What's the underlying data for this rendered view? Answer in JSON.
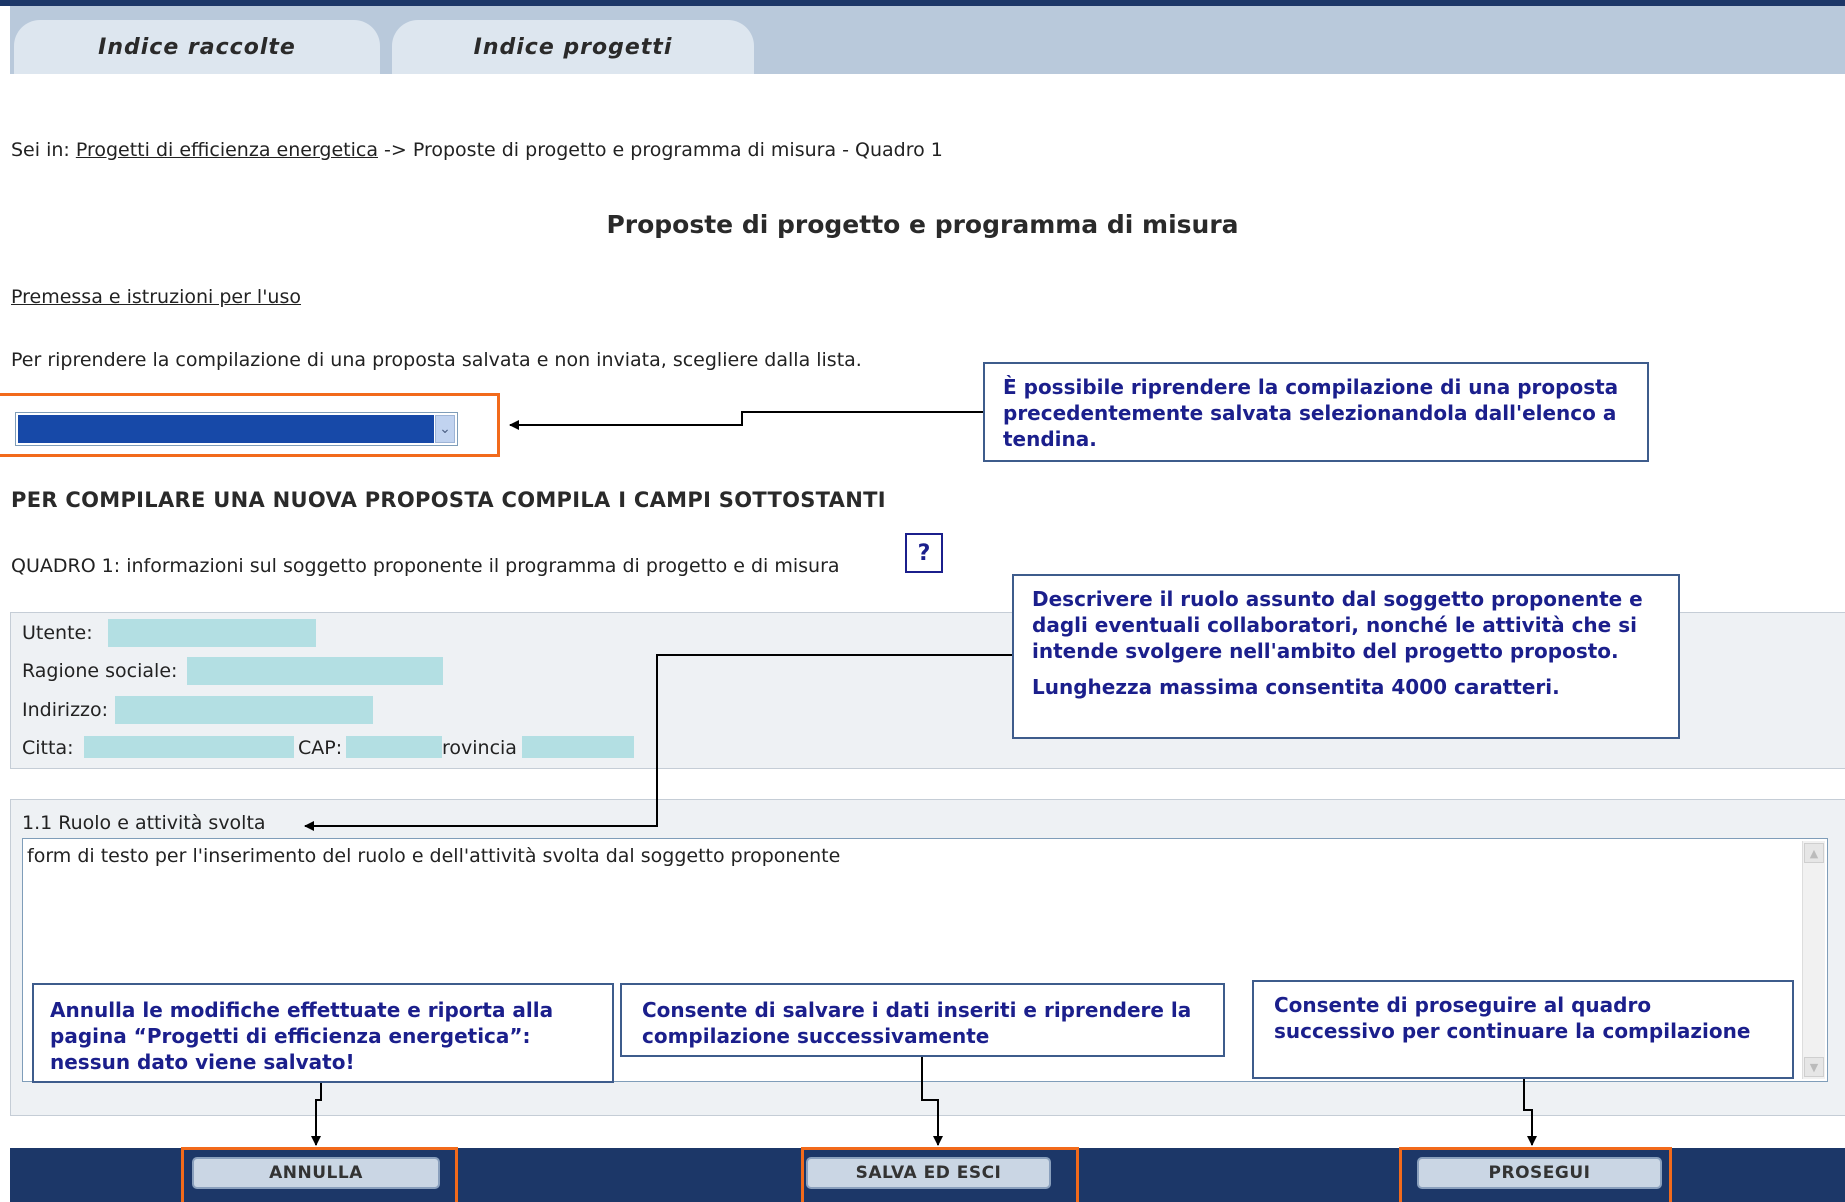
{
  "tabs": [
    {
      "label": "Indice raccolte"
    },
    {
      "label": "Indice progetti"
    }
  ],
  "breadcrumb": {
    "prefix": "Sei in:",
    "link": "Progetti di efficienza energetica",
    "current": "-> Proposte di progetto e programma di misura - Quadro 1"
  },
  "page_title": "Proposte di progetto e programma di misura",
  "instructions_link": "Premessa e istruzioni per l'uso",
  "resume_text": "Per riprendere la compilazione di una proposta salvata e non inviata, scegliere dalla lista.",
  "new_proposal_heading": "PER COMPILARE UNA NUOVA PROPOSTA COMPILA I CAMPI SOTTOSTANTI",
  "quadro_label": "QUADRO 1: informazioni sul soggetto proponente il programma di progetto e di misura",
  "help_icon": "help-cursor-icon",
  "fields": {
    "utente": "Utente:",
    "ragione_sociale": "Ragione sociale:",
    "indirizzo": "Indirizzo:",
    "citta": "Citta:",
    "cap": "CAP:",
    "provincia": "rovincia"
  },
  "section_1_1": {
    "label": "1.1 Ruolo e attività svolta",
    "textarea_value": "form di testo per l'inserimento del ruolo e dell'attività svolta dal soggetto proponente"
  },
  "callouts": {
    "dropdown": "È possibile riprendere la compilazione di una proposta precedentemente salvata selezionandola dall'elenco a tendina.",
    "role_line1": "Descrivere il ruolo assunto dal soggetto proponente e dagli eventuali collaboratori, nonché le attività che si intende svolgere nell'ambito del progetto proposto.",
    "role_line2": "Lunghezza massima consentita 4000 caratteri.",
    "annulla": "Annulla le modifiche effettuate e riporta alla pagina “Progetti di efficienza energetica”: nessun dato viene salvato!",
    "salva": "Consente di salvare i dati inseriti e riprendere la compilazione successivamente",
    "prosegui": "Consente di proseguire al quadro successivo per continuare la compilazione"
  },
  "buttons": {
    "annulla": "ANNULLA",
    "salva": "SALVA ED ESCI",
    "prosegui": "PROSEGUI"
  },
  "colors": {
    "header_navy": "#1c3768",
    "tab_bg": "#dde6ef",
    "highlight_orange": "#f26a1b",
    "callout_text": "#1b1f8c",
    "field_fill": "#b3dfe3"
  }
}
